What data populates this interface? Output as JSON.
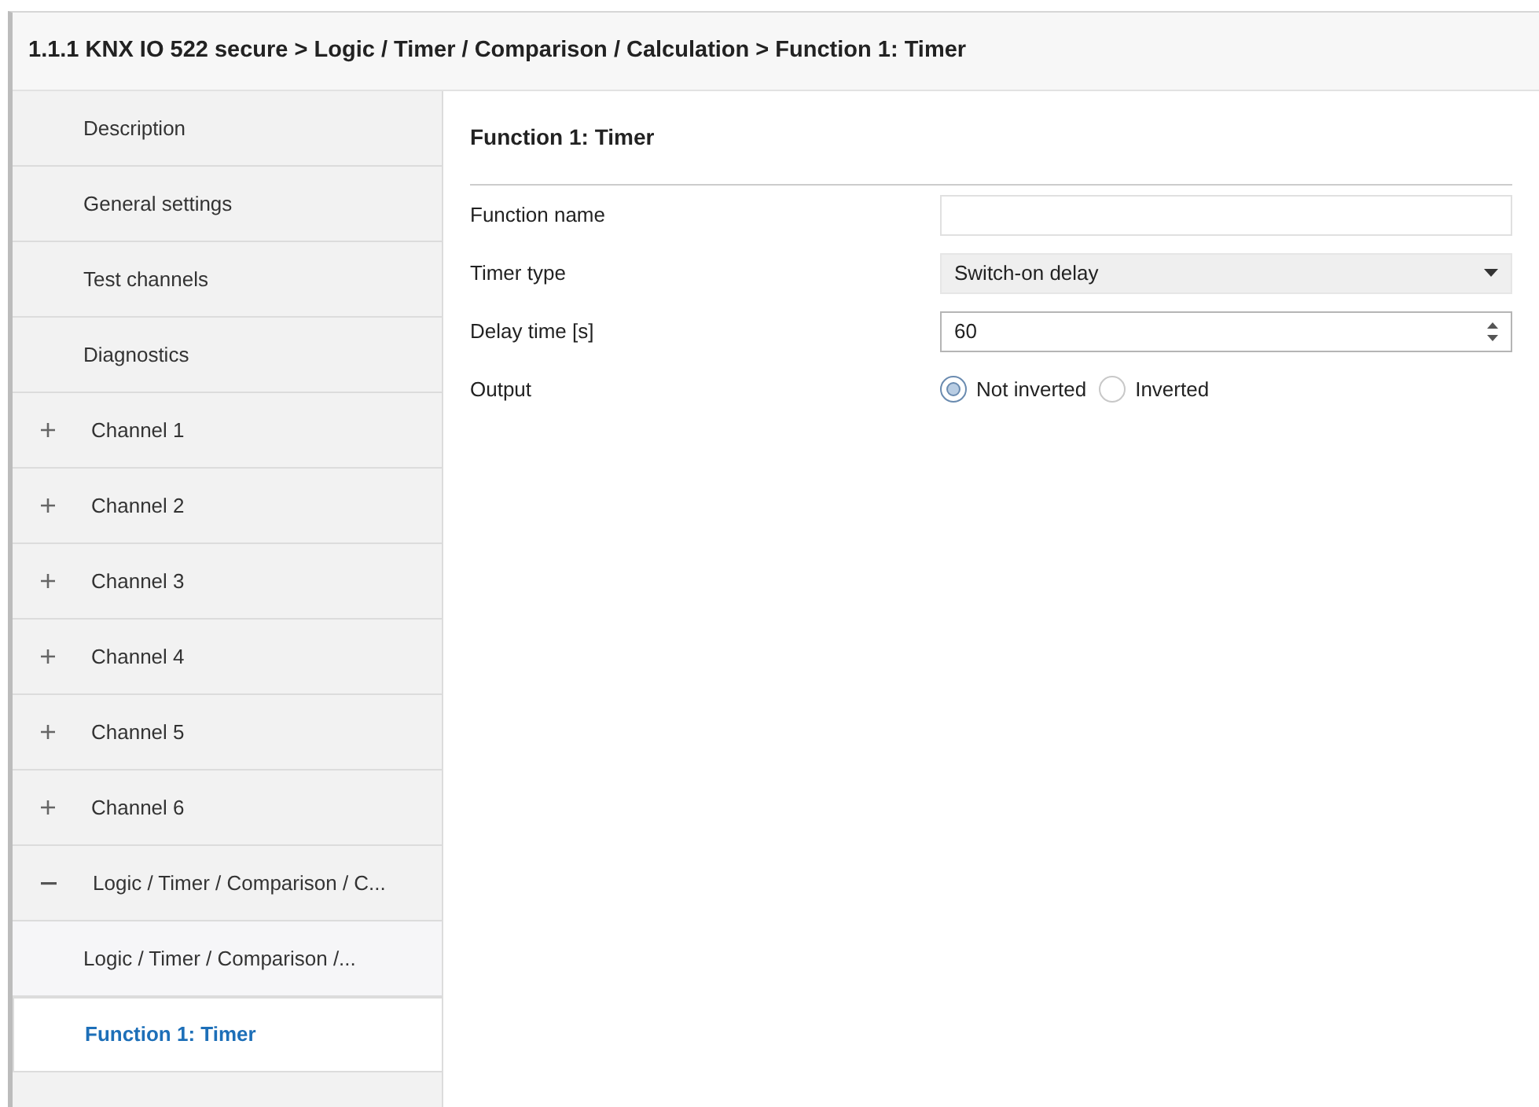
{
  "window": {
    "title": "1.1.1 KNX IO 522 secure > Logic / Timer / Comparison / Calculation > Function 1: Timer"
  },
  "sidebar": {
    "items": [
      {
        "kind": "page",
        "label": "Description",
        "selected": false
      },
      {
        "kind": "page",
        "label": "General settings",
        "selected": false
      },
      {
        "kind": "page",
        "label": "Test channels",
        "selected": false
      },
      {
        "kind": "page",
        "label": "Diagnostics",
        "selected": false
      },
      {
        "kind": "group",
        "label": "Channel 1",
        "expanded": false,
        "selected": false
      },
      {
        "kind": "group",
        "label": "Channel 2",
        "expanded": false,
        "selected": false
      },
      {
        "kind": "group",
        "label": "Channel 3",
        "expanded": false,
        "selected": false
      },
      {
        "kind": "group",
        "label": "Channel 4",
        "expanded": false,
        "selected": false
      },
      {
        "kind": "group",
        "label": "Channel 5",
        "expanded": false,
        "selected": false
      },
      {
        "kind": "group",
        "label": "Channel 6",
        "expanded": false,
        "selected": false
      },
      {
        "kind": "group",
        "label": "Logic / Timer / Comparison / C...",
        "expanded": true,
        "selected": false,
        "children": [
          {
            "label": "Logic / Timer / Comparison /...",
            "selected": false
          },
          {
            "label": "Function 1: Timer",
            "selected": true
          }
        ]
      }
    ]
  },
  "content": {
    "heading": "Function 1: Timer",
    "parameters": [
      {
        "kind": "text",
        "label": "Function name"
      },
      {
        "kind": "select",
        "label": "Timer type",
        "value": "Switch-on delay"
      },
      {
        "kind": "number",
        "label": "Delay time [s]",
        "value": "60"
      },
      {
        "kind": "radio",
        "label": "Output",
        "options": [
          {
            "label": "Not inverted",
            "selected": true
          },
          {
            "label": "Inverted",
            "selected": false
          }
        ]
      }
    ]
  }
}
